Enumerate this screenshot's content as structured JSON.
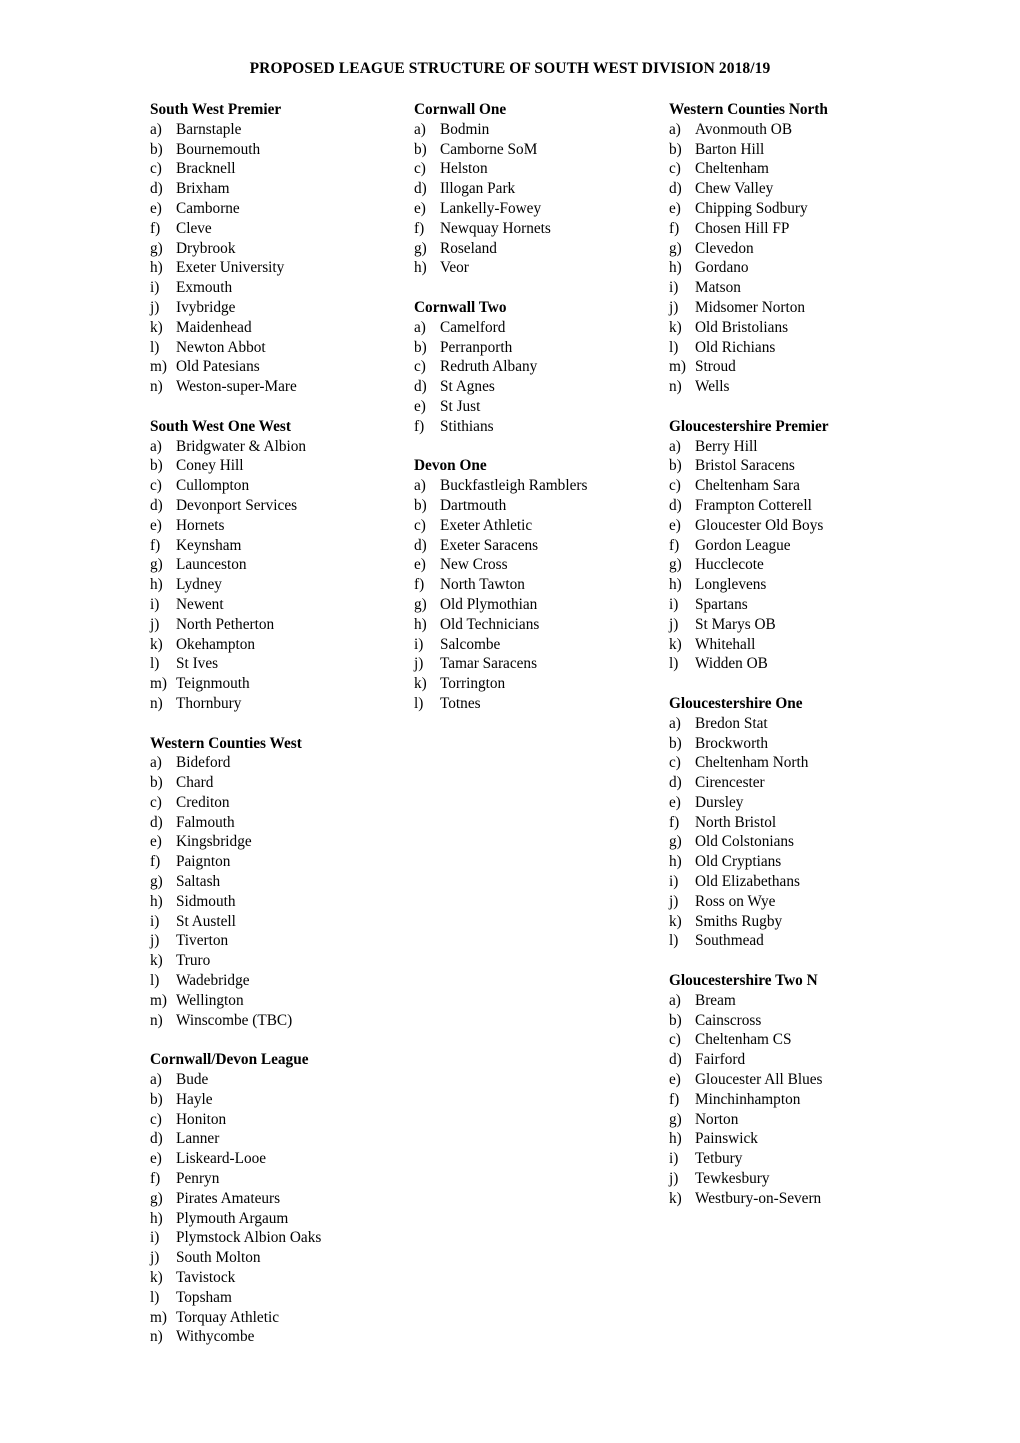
{
  "document": {
    "title": "PROPOSED LEAGUE STRUCTURE OF SOUTH WEST DIVISION 2018/19",
    "markers": [
      "a)",
      "b)",
      "c)",
      "d)",
      "e)",
      "f)",
      "g)",
      "h)",
      "i)",
      "j)",
      "k)",
      "l)",
      "m)",
      "n)"
    ]
  },
  "columns": [
    {
      "id": "left",
      "leagues": [
        {
          "name": "South West Premier",
          "clubs": [
            "Barnstaple",
            "Bournemouth",
            "Bracknell",
            "Brixham",
            "Camborne",
            "Cleve",
            "Drybrook",
            "Exeter University",
            "Exmouth",
            "Ivybridge",
            "Maidenhead",
            "Newton Abbot",
            "Old Patesians",
            "Weston-super-Mare"
          ]
        },
        {
          "name": "South West One West",
          "clubs": [
            "Bridgwater & Albion",
            "Coney Hill",
            "Cullompton",
            "Devonport Services",
            "Hornets",
            "Keynsham",
            "Launceston",
            "Lydney",
            "Newent",
            "North Petherton",
            "Okehampton",
            "St Ives",
            "Teignmouth",
            "Thornbury"
          ]
        },
        {
          "name": "Western Counties West",
          "clubs": [
            "Bideford",
            "Chard",
            "Crediton",
            "Falmouth",
            "Kingsbridge",
            "Paignton",
            "Saltash",
            "Sidmouth",
            "St Austell",
            "Tiverton",
            "Truro",
            "Wadebridge",
            "Wellington",
            "Winscombe (TBC)"
          ]
        },
        {
          "name": "Cornwall/Devon League",
          "clubs": [
            "Bude",
            "Hayle",
            "Honiton",
            "Lanner",
            "Liskeard-Looe",
            "Penryn",
            "Pirates Amateurs",
            "Plymouth Argaum",
            "Plymstock Albion Oaks",
            "South Molton",
            "Tavistock",
            "Topsham",
            "Torquay Athletic",
            "Withycombe"
          ]
        }
      ]
    },
    {
      "id": "middle",
      "leagues": [
        {
          "name": "Cornwall One",
          "clubs": [
            "Bodmin",
            "Camborne SoM",
            "Helston",
            "Illogan Park",
            "Lankelly-Fowey",
            "Newquay Hornets",
            "Roseland",
            "Veor"
          ]
        },
        {
          "name": "Cornwall Two",
          "clubs": [
            "Camelford",
            "Perranporth",
            "Redruth Albany",
            "St Agnes",
            "St Just",
            "Stithians"
          ]
        },
        {
          "name": "Devon One",
          "clubs": [
            "Buckfastleigh Ramblers",
            "Dartmouth",
            "Exeter Athletic",
            "Exeter Saracens",
            "New Cross",
            "North Tawton",
            "Old Plymothian",
            "Old Technicians",
            "Salcombe",
            "Tamar Saracens",
            "Torrington",
            "Totnes"
          ]
        }
      ]
    },
    {
      "id": "right",
      "leagues": [
        {
          "name": "Western Counties North",
          "clubs": [
            "Avonmouth OB",
            "Barton Hill",
            "Cheltenham",
            "Chew Valley",
            "Chipping Sodbury",
            "Chosen Hill FP",
            "Clevedon",
            "Gordano",
            "Matson",
            "Midsomer Norton",
            "Old Bristolians",
            "Old Richians",
            "Stroud",
            "Wells"
          ]
        },
        {
          "name": "Gloucestershire Premier",
          "clubs": [
            "Berry Hill",
            "Bristol Saracens",
            "Cheltenham Sara",
            "Frampton Cotterell",
            "Gloucester Old Boys",
            "Gordon League",
            "Hucclecote",
            "Longlevens",
            "Spartans",
            "St Marys OB",
            "Whitehall",
            "Widden OB"
          ]
        },
        {
          "name": "Gloucestershire One",
          "clubs": [
            "Bredon Stat",
            "Brockworth",
            "Cheltenham North",
            "Cirencester",
            "Dursley",
            "North Bristol",
            "Old Colstonians",
            "Old Cryptians",
            "Old Elizabethans",
            "Ross on Wye",
            "Smiths Rugby",
            "Southmead"
          ]
        },
        {
          "name": "Gloucestershire Two N",
          "clubs": [
            "Bream",
            "Cainscross",
            "Cheltenham CS",
            "Fairford",
            "Gloucester All Blues",
            "Minchinhampton",
            "Norton",
            "Painswick",
            "Tetbury",
            "Tewkesbury",
            "Westbury-on-Severn"
          ]
        }
      ]
    }
  ]
}
